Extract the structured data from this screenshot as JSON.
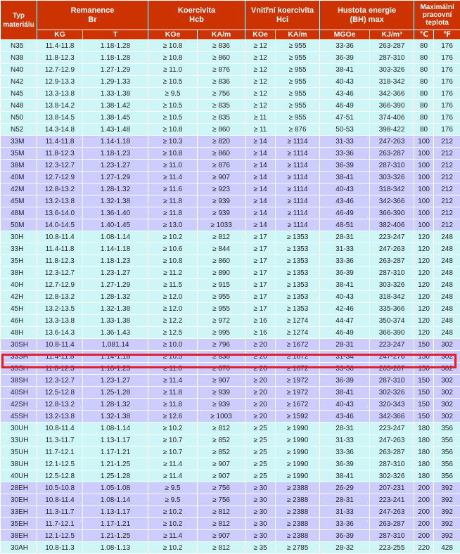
{
  "header": {
    "type_label": "Typ materiálu",
    "groups": [
      {
        "title": "Remanence",
        "sub": "Br"
      },
      {
        "title": "Koercivita",
        "sub": "Hcb"
      },
      {
        "title": "Vnitřní koercivita",
        "sub": "Hci"
      },
      {
        "title": "Hustota energie",
        "sub": "(BH) max"
      },
      {
        "title": "Maximální pracovní teplota",
        "sub": ""
      }
    ],
    "units": [
      "KG",
      "T",
      "KOe",
      "KA/m",
      "KOe",
      "KA/m",
      "MGOe",
      "KJ/m³",
      "℃",
      "℉"
    ]
  },
  "rows": [
    {
      "g": 0,
      "c": [
        "N35",
        "11.4-11.8",
        "1.18-1.28",
        "≥ 10.8",
        "≥ 836",
        "≥ 12",
        "≥ 955",
        "33-36",
        "263-287",
        "80",
        "176"
      ]
    },
    {
      "g": 0,
      "c": [
        "N38",
        "11.8-12.3",
        "1.18-1.28",
        "≥ 10.8",
        "≥ 860",
        "≥ 12",
        "≥ 955",
        "36-39",
        "287-310",
        "80",
        "176"
      ]
    },
    {
      "g": 0,
      "c": [
        "N40",
        "12.7-12.9",
        "1.27-1.29",
        "≥ 11.0",
        "≥ 876",
        "≥ 12",
        "≥ 955",
        "38-41",
        "303-326",
        "80",
        "176"
      ]
    },
    {
      "g": 0,
      "c": [
        "N42",
        "12.9-13.3",
        "1.29-1.33",
        "≥ 10.5",
        "≥ 836",
        "≥ 12",
        "≥ 955",
        "40-43",
        "318-342",
        "80",
        "176"
      ]
    },
    {
      "g": 0,
      "c": [
        "N45",
        "13.3-13.8",
        "1.33-1.38",
        "≥ 9.5",
        "≥ 756",
        "≥ 12",
        "≥ 955",
        "43-46",
        "342-366",
        "80",
        "176"
      ]
    },
    {
      "g": 0,
      "c": [
        "N48",
        "13.8-14.2",
        "1.38-1.42",
        "≥ 10.5",
        "≥ 835",
        "≥ 12",
        "≥ 955",
        "46-49",
        "366-390",
        "80",
        "176"
      ]
    },
    {
      "g": 0,
      "c": [
        "N50",
        "13.8-14.5",
        "1.38-1.45",
        "≥ 10.5",
        "≥ 835",
        "≥ 11",
        "≥ 955",
        "47-51",
        "374-406",
        "80",
        "176"
      ]
    },
    {
      "g": 0,
      "c": [
        "N52",
        "14.3-14.8",
        "1.43-1.48",
        "≥ 10.8",
        "≥ 860",
        "≥ 11",
        "≥ 876",
        "50-53",
        "398-422",
        "80",
        "176"
      ]
    },
    {
      "g": 1,
      "c": [
        "33M",
        "11.4-11.8",
        "1.14-1.18",
        "≥ 10.3",
        "≥ 820",
        "≥ 14",
        "≥ 1114",
        "31-33",
        "247-263",
        "100",
        "212"
      ]
    },
    {
      "g": 1,
      "c": [
        "35M",
        "11.8-12.3",
        "1.18-1.23",
        "≥ 10.8",
        "≥ 860",
        "≥ 14",
        "≥ 1114",
        "33-36",
        "263-287",
        "100",
        "212"
      ]
    },
    {
      "g": 1,
      "c": [
        "38M",
        "12.3-12.7",
        "1.23-1.27",
        "≥ 11.0",
        "≥ 876",
        "≥ 14",
        "≥ 1114",
        "36-39",
        "287-310",
        "100",
        "212"
      ]
    },
    {
      "g": 1,
      "c": [
        "40M",
        "12.7-12.9",
        "1.27-1.29",
        "≥ 11.4",
        "≥ 907",
        "≥ 14",
        "≥ 1114",
        "38-41",
        "303-326",
        "100",
        "212"
      ]
    },
    {
      "g": 1,
      "c": [
        "42M",
        "12.8-13.2",
        "1.28-1.32",
        "≥ 11.6",
        "≥ 923",
        "≥ 14",
        "≥ 1114",
        "40-43",
        "318-342",
        "100",
        "212"
      ]
    },
    {
      "g": 1,
      "c": [
        "45M",
        "13.2-13.8",
        "1.32-1.38",
        "≥ 11.8",
        "≥ 939",
        "≥ 14",
        "≥ 1114",
        "43-46",
        "342-366",
        "100",
        "212"
      ]
    },
    {
      "g": 1,
      "c": [
        "48M",
        "13.6-14.0",
        "1.36-1.40",
        "≥ 11.8",
        "≥ 939",
        "≥ 14",
        "≥ 1114",
        "46-49",
        "366-390",
        "100",
        "212"
      ]
    },
    {
      "g": 1,
      "c": [
        "50M",
        "14.0-14.5",
        "1.40-1.45",
        "≥ 13.0",
        "≥ 1033",
        "≥ 14",
        "≥ 1114",
        "48-51",
        "382-406",
        "100",
        "212"
      ]
    },
    {
      "g": 0,
      "c": [
        "30H",
        "10.8-11.4",
        "1.08-1.14",
        "≥ 10.2",
        "≥ 812",
        "≥ 17",
        "≥ 1353",
        "28-31",
        "223-247",
        "120",
        "248"
      ]
    },
    {
      "g": 0,
      "c": [
        "33H",
        "11.4-11.8",
        "1.14-1.18",
        "≥ 10.6",
        "≥ 844",
        "≥ 17",
        "≥ 1353",
        "31-33",
        "247-263",
        "120",
        "248"
      ]
    },
    {
      "g": 0,
      "c": [
        "35H",
        "11.8-12.3",
        "1.18-1.23",
        "≥ 10.8",
        "≥ 860",
        "≥ 17",
        "≥ 1353",
        "33-36",
        "263-287",
        "120",
        "248"
      ]
    },
    {
      "g": 0,
      "c": [
        "38H",
        "12.3-12.7",
        "1.23-1.27",
        "≥ 11.2",
        "≥ 890",
        "≥ 17",
        "≥ 1353",
        "36-39",
        "287-310",
        "120",
        "248"
      ]
    },
    {
      "g": 0,
      "c": [
        "40H",
        "12.7-12.9",
        "1.27-1.29",
        "≥ 11.5",
        "≥ 915",
        "≥ 17",
        "≥ 1353",
        "38-41",
        "303-326",
        "120",
        "248"
      ]
    },
    {
      "g": 0,
      "c": [
        "42H",
        "12.8-13.2",
        "1.28-1.32",
        "≥ 12.0",
        "≥ 955",
        "≥ 17",
        "≥ 1353",
        "40-43",
        "318-342",
        "120",
        "248"
      ]
    },
    {
      "g": 0,
      "c": [
        "45H",
        "13.2-13.5",
        "1.32-1.38",
        "≥ 12.0",
        "≥ 955",
        "≥ 17",
        "≥ 1353",
        "42-46",
        "335-366",
        "120",
        "248"
      ]
    },
    {
      "g": 0,
      "c": [
        "46H",
        "13.3-13.8",
        "1.33-1.38",
        "≥ 12.2",
        "≥ 972",
        "≥ 16",
        "≥ 1274",
        "44-47",
        "350-374",
        "120",
        "248"
      ]
    },
    {
      "g": 0,
      "c": [
        "48H",
        "13.6-14.3",
        "1.36-1.43",
        "≥ 12.5",
        "≥ 995",
        "≥ 16",
        "≥ 1274",
        "46-49",
        "366-390",
        "120",
        "248"
      ]
    },
    {
      "g": 1,
      "c": [
        "30SH",
        "10.8-11.4",
        "1.081.14",
        "≥ 10.0",
        "≥ 796",
        "≥ 20",
        "≥ 1672",
        "28-31",
        "223-247",
        "150",
        "302"
      ]
    },
    {
      "g": 1,
      "c": [
        "33SH",
        "11.4-11.8",
        "1.14-1.18",
        "≥ 10.5",
        "≥ 836",
        "≥ 20",
        "≥ 1672",
        "31-34",
        "247-276",
        "150",
        "302"
      ]
    },
    {
      "g": 1,
      "c": [
        "35SH",
        "11.8-12.3",
        "1.18-1.23",
        "≥ 11.0",
        "≥ 876",
        "≥ 20",
        "≥ 1672",
        "33-36",
        "263-287",
        "150",
        "302"
      ]
    },
    {
      "g": 1,
      "c": [
        "38SH",
        "12.3-12.7",
        "1.23-1.27",
        "≥ 11.4",
        "≥ 907",
        "≥ 20",
        "≥ 1972",
        "36-39",
        "287-310",
        "150",
        "302"
      ],
      "hl": true
    },
    {
      "g": 1,
      "c": [
        "40SH",
        "12.5-12.8",
        "1.25-1.28",
        "≥ 11.8",
        "≥ 939",
        "≥ 20",
        "≥ 1972",
        "38-41",
        "302-326",
        "150",
        "302"
      ]
    },
    {
      "g": 1,
      "c": [
        "42SH",
        "12.8-13.2",
        "1.28-1.32",
        "≥ 11.8",
        "≥ 939",
        "≥ 20",
        "≥ 1672",
        "40-43",
        "320-343",
        "150",
        "302"
      ]
    },
    {
      "g": 1,
      "c": [
        "45SH",
        "13.2-13.8",
        "1.32-1.38",
        "≥ 12.6",
        "≥ 1003",
        "≥ 20",
        "≥ 1592",
        "43-46",
        "342-366",
        "150",
        "302"
      ]
    },
    {
      "g": 0,
      "c": [
        "30UH",
        "10.8-11.4",
        "1.08-1.14",
        "≥ 10.2",
        "≥ 812",
        "≥ 25",
        "≥ 1990",
        "28-31",
        "223-247",
        "180",
        "356"
      ]
    },
    {
      "g": 0,
      "c": [
        "33UH",
        "11.3-11.7",
        "1.13-1.17",
        "≥ 10.7",
        "≥ 852",
        "≥ 25",
        "≥ 1990",
        "31-33",
        "247-263",
        "180",
        "356"
      ]
    },
    {
      "g": 0,
      "c": [
        "35UH",
        "11.7-12.1",
        "1.17-1.21",
        "≥ 10.7",
        "≥ 852",
        "≥ 25",
        "≥ 1990",
        "33-36",
        "263-287",
        "180",
        "356"
      ]
    },
    {
      "g": 0,
      "c": [
        "38UH",
        "12.1-12.5",
        "1.21-1.25",
        "≥ 11.4",
        "≥ 907",
        "≥ 25",
        "≥ 1990",
        "36-39",
        "287-310",
        "180",
        "356"
      ]
    },
    {
      "g": 0,
      "c": [
        "40UH",
        "12.5-12.8",
        "1.25-1.28",
        "≥ 11.4",
        "≥ 907",
        "≥ 25",
        "≥ 1990",
        "38-41",
        "302-326",
        "180",
        "356"
      ]
    },
    {
      "g": 1,
      "c": [
        "28EH",
        "10.5-10.8",
        "1.05-1.08",
        "≥ 9.5",
        "≥ 756",
        "≥ 30",
        "≥ 2388",
        "26-29",
        "207-231",
        "200",
        "392"
      ]
    },
    {
      "g": 1,
      "c": [
        "30EH",
        "10.8-11.4",
        "1.08-1.14",
        "≥ 9.5",
        "≥ 756",
        "≥ 30",
        "≥ 2388",
        "28-31",
        "223-241",
        "200",
        "392"
      ]
    },
    {
      "g": 1,
      "c": [
        "33EH",
        "11.3-11.7",
        "1.13-1.17",
        "≥ 10.2",
        "≥ 812",
        "≥ 30",
        "≥ 2388",
        "31-33",
        "247-263",
        "200",
        "392"
      ]
    },
    {
      "g": 1,
      "c": [
        "35EH",
        "11.7-12.1",
        "1.17-1.21",
        "≥ 10.2",
        "≥ 812",
        "≥ 30",
        "≥ 2388",
        "33-36",
        "263-287",
        "200",
        "392"
      ]
    },
    {
      "g": 1,
      "c": [
        "38EH",
        "12.1-12.5",
        "1.21-1.25",
        "≥ 11.4",
        "≥ 907",
        "≥ 30",
        "≥ 2388",
        "36-39",
        "287-310",
        "200",
        "392"
      ]
    },
    {
      "g": 0,
      "c": [
        "30AH",
        "10.8-11.3",
        "1.08-1.13",
        "≥ 10.2",
        "≥ 812",
        "≥ 35",
        "≥ 2785",
        "28-32",
        "223-255",
        "220",
        "428"
      ]
    }
  ]
}
